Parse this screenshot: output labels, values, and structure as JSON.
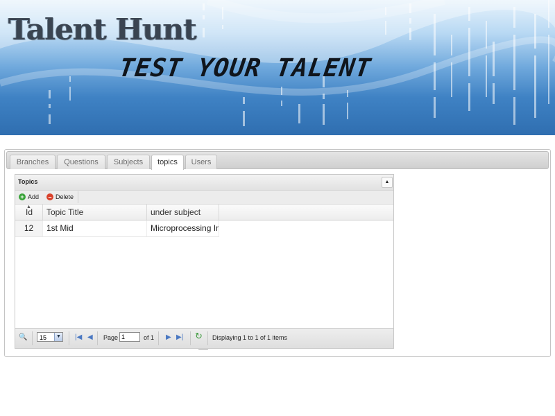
{
  "banner": {
    "title": "Talent Hunt",
    "tagline": "TEST YOUR TALENT"
  },
  "tabs": [
    {
      "label": "Branches",
      "active": false
    },
    {
      "label": "Questions",
      "active": false
    },
    {
      "label": "Subjects",
      "active": false
    },
    {
      "label": "topics",
      "active": true
    },
    {
      "label": "Users",
      "active": false
    }
  ],
  "grid": {
    "title": "Topics",
    "collapse_icon": "triangle-up-icon",
    "toolbar": {
      "add_label": "Add",
      "delete_label": "Delete"
    },
    "columns": [
      "Id",
      "Topic Title",
      "under subject"
    ],
    "rows": [
      [
        "12",
        "1st Mid",
        "Microprocessing In"
      ]
    ]
  },
  "pager": {
    "rows_per_page": "15",
    "page_label": "Page",
    "current_page": "1",
    "of_label": "of 1",
    "status": "Displaying 1 to 1 of 1 items"
  },
  "colors": {
    "add": "#3aa33a",
    "delete": "#d9422c",
    "nav": "#4a78c2",
    "refresh": "#3f9b3f"
  }
}
